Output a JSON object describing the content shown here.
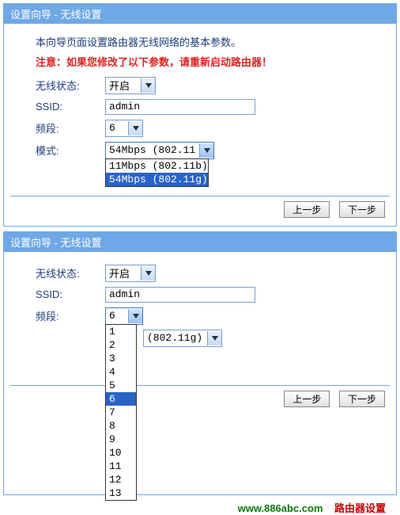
{
  "wizard_title": "设置向导 - 无线设置",
  "intro": "本向导页面设置路由器无线网络的基本参数。",
  "warn": "注意：如果您修改了以下参数，请重新启动路由器！",
  "labels": {
    "wireless_state": "无线状态:",
    "ssid": "SSID:",
    "channel": "频段:",
    "mode": "模式:"
  },
  "values": {
    "wireless_state": "开启",
    "ssid": "admin",
    "channel": "6",
    "mode": "54Mbps (802.11g)"
  },
  "buttons": {
    "prev": "上一步",
    "next": "下一步"
  },
  "mode_options": [
    {
      "label": "11Mbps (802.11b)",
      "selected": false
    },
    {
      "label": "54Mbps (802.11g)",
      "selected": true
    }
  ],
  "channel_options": [
    {
      "label": "1",
      "selected": false
    },
    {
      "label": "2",
      "selected": false
    },
    {
      "label": "3",
      "selected": false
    },
    {
      "label": "4",
      "selected": false
    },
    {
      "label": "5",
      "selected": false
    },
    {
      "label": "6",
      "selected": true
    },
    {
      "label": "7",
      "selected": false
    },
    {
      "label": "8",
      "selected": false
    },
    {
      "label": "9",
      "selected": false
    },
    {
      "label": "10",
      "selected": false
    },
    {
      "label": "11",
      "selected": false
    },
    {
      "label": "12",
      "selected": false
    },
    {
      "label": "13",
      "selected": false
    }
  ],
  "mode_after_channel": "(802.11g)",
  "footer": {
    "url": "www.886abc.com",
    "tagline": "路由器设置"
  }
}
